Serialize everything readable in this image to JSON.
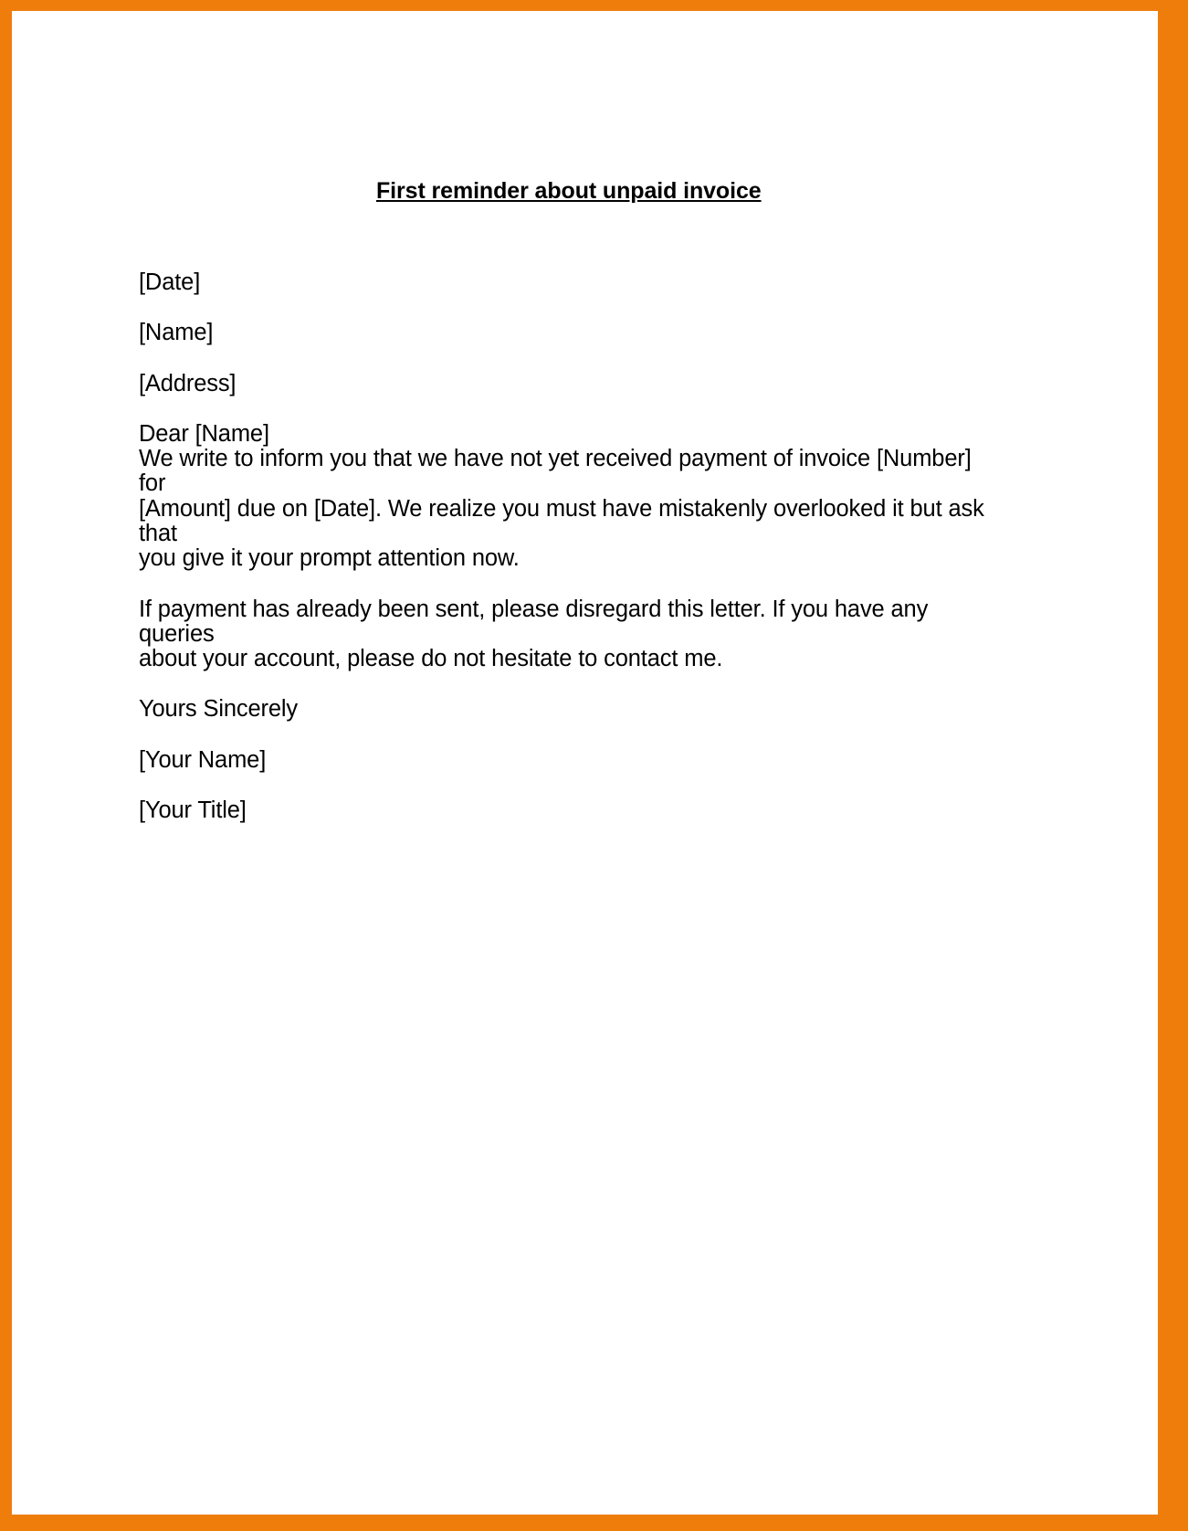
{
  "document": {
    "title": "First reminder about unpaid invoice",
    "border_color": "#ef7d0c",
    "page_background": "#ffffff",
    "text_color": "#000000",
    "fields": {
      "date": "[Date]",
      "name": "[Name]",
      "address": "[Address]"
    },
    "salutation": "Dear [Name]",
    "body_paragraph_1": [
      "We write to inform you that we have not yet received payment of invoice [Number] for",
      "[Amount] due on [Date]. We realize you must have mistakenly overlooked it but ask that",
      "you give it your prompt attention now."
    ],
    "body_paragraph_2": [
      "If payment has already been sent, please disregard this letter. If you have any queries",
      "about your account, please do not hesitate to contact me."
    ],
    "closing": "Yours Sincerely",
    "signature_name": "[Your Name]",
    "signature_title": "[Your Title]"
  }
}
